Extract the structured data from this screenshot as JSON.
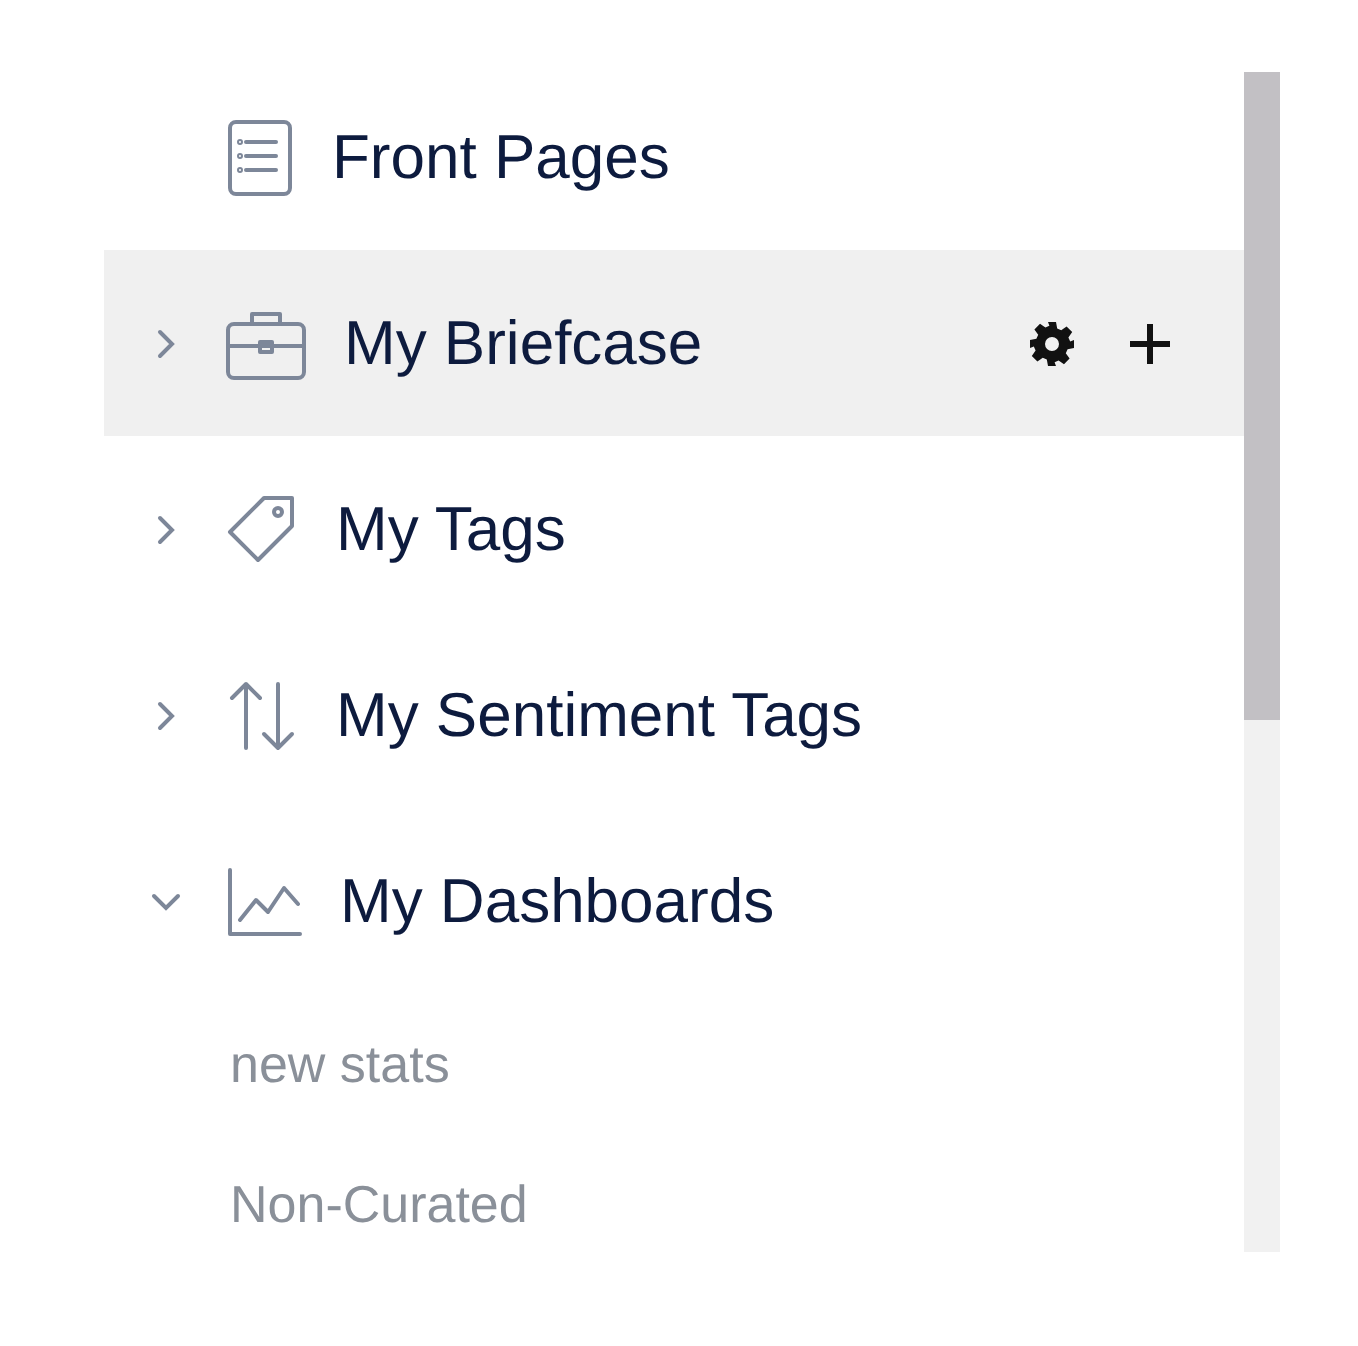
{
  "nav": {
    "items": [
      {
        "label": "Front Pages",
        "selected": false
      },
      {
        "label": "My Briefcase",
        "selected": true,
        "expanded": false
      },
      {
        "label": "My Tags",
        "selected": false,
        "expanded": false
      },
      {
        "label": "My Sentiment Tags",
        "selected": false,
        "expanded": false
      },
      {
        "label": "My Dashboards",
        "selected": false,
        "expanded": true,
        "children": [
          {
            "label": "new stats"
          },
          {
            "label": "Non-Curated"
          }
        ]
      }
    ]
  }
}
